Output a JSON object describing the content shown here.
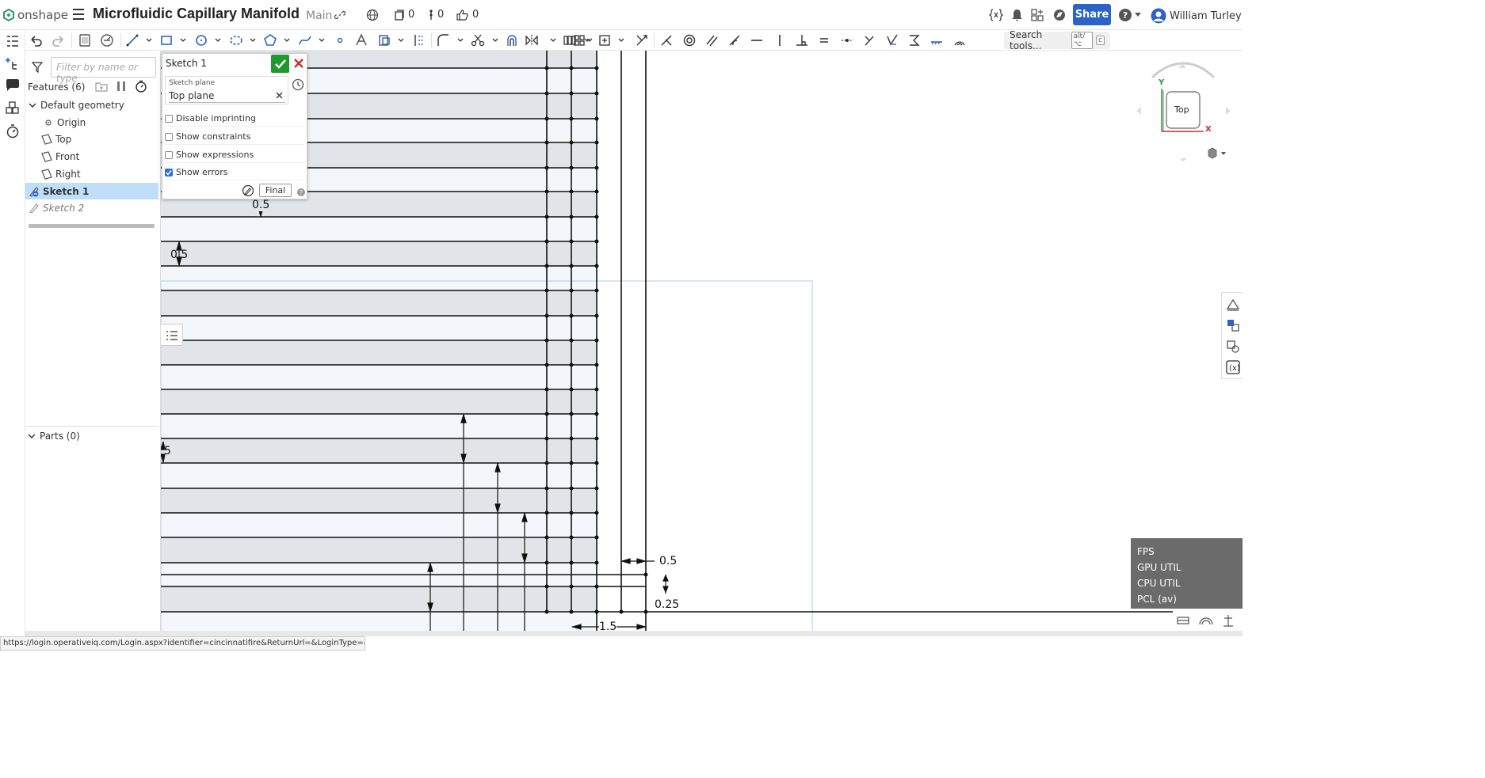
{
  "app": {
    "logo_text": "onshape",
    "document_title": "Microfluidic Capillary Manifold",
    "branch": "Main",
    "counters": [
      {
        "icon": "versions-icon",
        "value": "0"
      },
      {
        "icon": "branch-icon",
        "value": "0"
      },
      {
        "icon": "like-icon",
        "value": "0"
      }
    ],
    "share_label": "Share",
    "help_label": "?",
    "user_name": "William Turley"
  },
  "toolbar": {
    "search_label": "Search tools...",
    "search_shortcut_1": "alt/⌥",
    "search_shortcut_2": "c"
  },
  "feature_tree": {
    "filter_placeholder": "Filter by name or type",
    "features_header": "Features (6)",
    "default_geometry_label": "Default geometry",
    "items": [
      {
        "label": "Origin",
        "icon": "origin-icon"
      },
      {
        "label": "Top",
        "icon": "plane-icon"
      },
      {
        "label": "Front",
        "icon": "plane-icon"
      },
      {
        "label": "Right",
        "icon": "plane-icon"
      },
      {
        "label": "Sketch 1",
        "icon": "sketch-icon",
        "selected": true
      },
      {
        "label": "Sketch 2",
        "icon": "sketch-icon",
        "selected": false
      }
    ],
    "parts_header": "Parts (0)"
  },
  "sketch_dialog": {
    "title": "Sketch 1",
    "plane_label": "Sketch plane",
    "plane_value": "Top plane",
    "options": [
      {
        "label": "Disable imprinting",
        "checked": false
      },
      {
        "label": "Show constraints",
        "checked": false
      },
      {
        "label": "Show expressions",
        "checked": false
      },
      {
        "label": "Show errors",
        "checked": true
      }
    ],
    "final_label": "Final",
    "help_label": "?"
  },
  "viewcube": {
    "face_label": "Top",
    "axis_y": "Y",
    "axis_x": "X"
  },
  "dimensions": {
    "d_top": "0.5",
    "d_mid": "0.5",
    "d_left": "5",
    "d_width": "0.5",
    "d_gap": "0.25",
    "d_bottom": "1.5"
  },
  "perf_overlay": [
    "FPS",
    "GPU UTIL",
    "CPU UTIL",
    "PCL (av)"
  ],
  "status_url": "https://login.operativeiq.com/Login.aspx?identifier=cincinnatifire&ReturnUrl=&LoginType=&check=IE",
  "colors": {
    "accent": "#2b64c6",
    "confirm": "#1e9a2e",
    "cancel": "#d42a2a",
    "selection": "#bfdff8",
    "channel_fill": "#e1e4e8"
  }
}
